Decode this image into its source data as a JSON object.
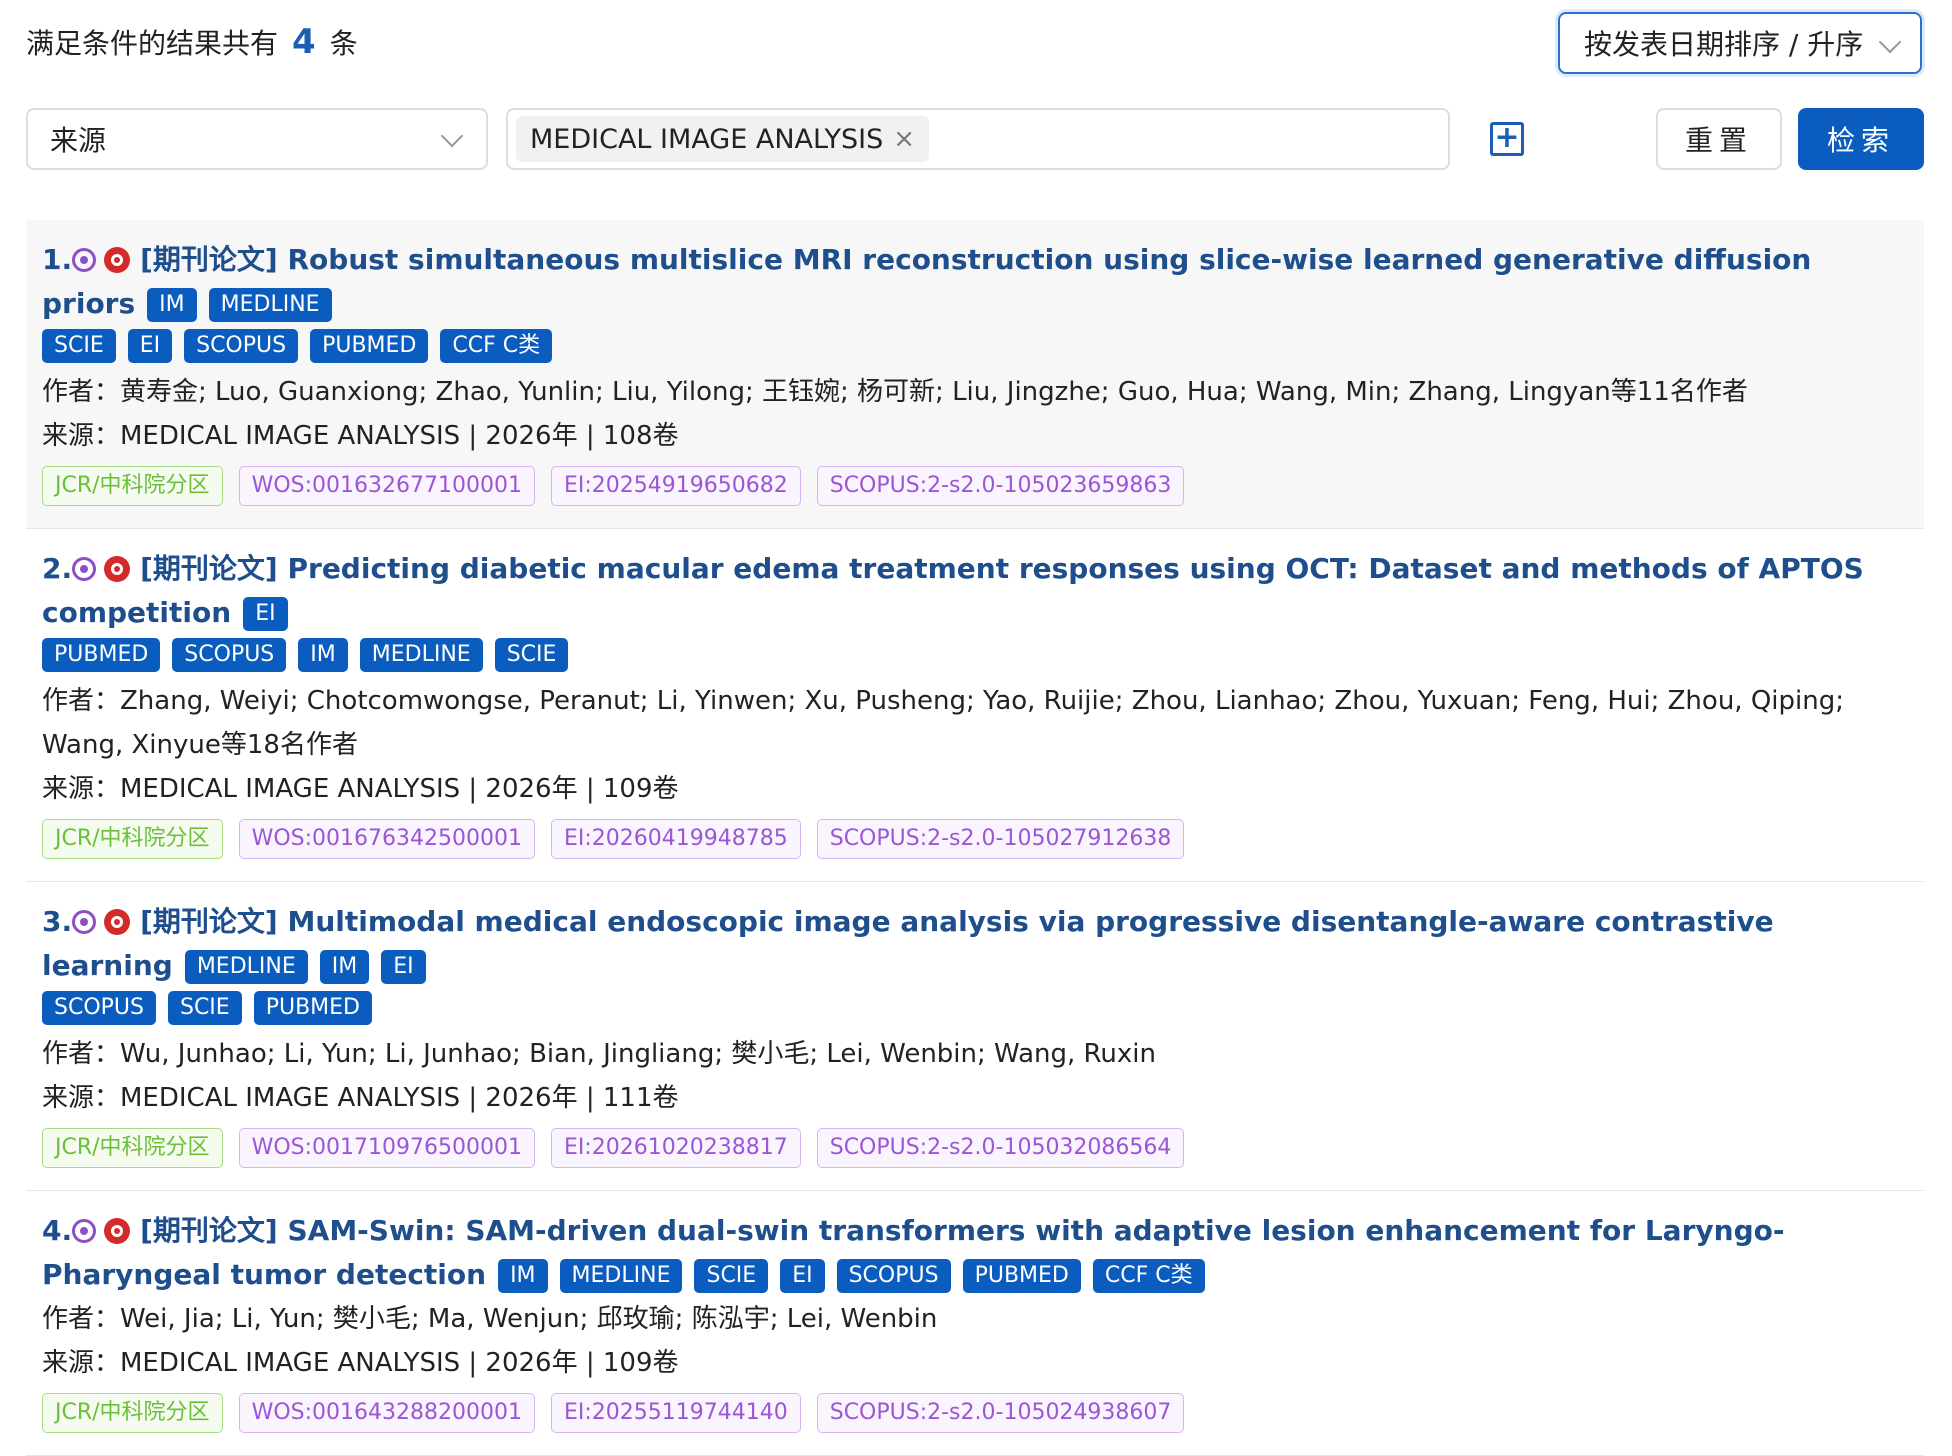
{
  "summary": {
    "prefix": "满足条件的结果共有",
    "count": "4",
    "suffix": "条"
  },
  "sort": {
    "value": "按发表日期排序 / 升序"
  },
  "filter": {
    "field": "来源",
    "tag": "MEDICAL IMAGE ANALYSIS",
    "tag_remove": "×",
    "add": "+",
    "reset": "重置",
    "search": "检索"
  },
  "results": [
    {
      "num": "1.",
      "type": "[期刊论文]",
      "title": "Robust simultaneous multislice MRI reconstruction using slice-wise learned generative diffusion priors",
      "inline_badges": [
        "IM",
        "MEDLINE"
      ],
      "badges": [
        "SCIE",
        "EI",
        "SCOPUS",
        "PUBMED",
        "CCF C类"
      ],
      "authors": "作者：黄寿金; Luo, Guanxiong; Zhao, Yunlin; Liu, Yilong; 王钰婉; 杨可新; Liu, Jingzhe; Guo, Hua; Wang, Min; Zhang, Lingyan等11名作者",
      "source": "来源：MEDICAL IMAGE ANALYSIS | 2026年 | 108卷",
      "ids": [
        "JCR/中科院分区",
        "WOS:001632677100001",
        "EI:20254919650682",
        "SCOPUS:2-s2.0-105023659863"
      ]
    },
    {
      "num": "2.",
      "type": "[期刊论文]",
      "title": "Predicting diabetic macular edema treatment responses using OCT: Dataset and methods of APTOS competition",
      "inline_badges": [
        "EI"
      ],
      "badges": [
        "PUBMED",
        "SCOPUS",
        "IM",
        "MEDLINE",
        "SCIE"
      ],
      "authors": "作者：Zhang, Weiyi; Chotcomwongse, Peranut; Li, Yinwen; Xu, Pusheng; Yao, Ruijie; Zhou, Lianhao; Zhou, Yuxuan; Feng, Hui; Zhou, Qiping; Wang, Xinyue等18名作者",
      "source": "来源：MEDICAL IMAGE ANALYSIS | 2026年 | 109卷",
      "ids": [
        "JCR/中科院分区",
        "WOS:001676342500001",
        "EI:20260419948785",
        "SCOPUS:2-s2.0-105027912638"
      ]
    },
    {
      "num": "3.",
      "type": "[期刊论文]",
      "title": "Multimodal medical endoscopic image analysis via progressive disentangle-aware contrastive learning",
      "inline_badges": [
        "MEDLINE",
        "IM",
        "EI"
      ],
      "badges": [
        "SCOPUS",
        "SCIE",
        "PUBMED"
      ],
      "authors": "作者：Wu, Junhao; Li, Yun; Li, Junhao; Bian, Jingliang; 樊小毛; Lei, Wenbin; Wang, Ruxin",
      "source": "来源：MEDICAL IMAGE ANALYSIS | 2026年 | 111卷",
      "ids": [
        "JCR/中科院分区",
        "WOS:001710976500001",
        "EI:20261020238817",
        "SCOPUS:2-s2.0-105032086564"
      ]
    },
    {
      "num": "4.",
      "type": "[期刊论文]",
      "title": "SAM-Swin: SAM-driven dual-swin transformers with adaptive lesion enhancement for Laryngo-Pharyngeal tumor detection",
      "inline_badges": [
        "IM",
        "MEDLINE",
        "SCIE",
        "EI",
        "SCOPUS",
        "PUBMED",
        "CCF C类"
      ],
      "badges": [],
      "authors": "作者：Wei, Jia; Li, Yun; 樊小毛; Ma, Wenjun; 邱玫瑜; 陈泓宇; Lei, Wenbin",
      "source": "来源：MEDICAL IMAGE ANALYSIS | 2026年 | 109卷",
      "ids": [
        "JCR/中科院分区",
        "WOS:001643288200001",
        "EI:20255119744140",
        "SCOPUS:2-s2.0-105024938607"
      ]
    }
  ]
}
